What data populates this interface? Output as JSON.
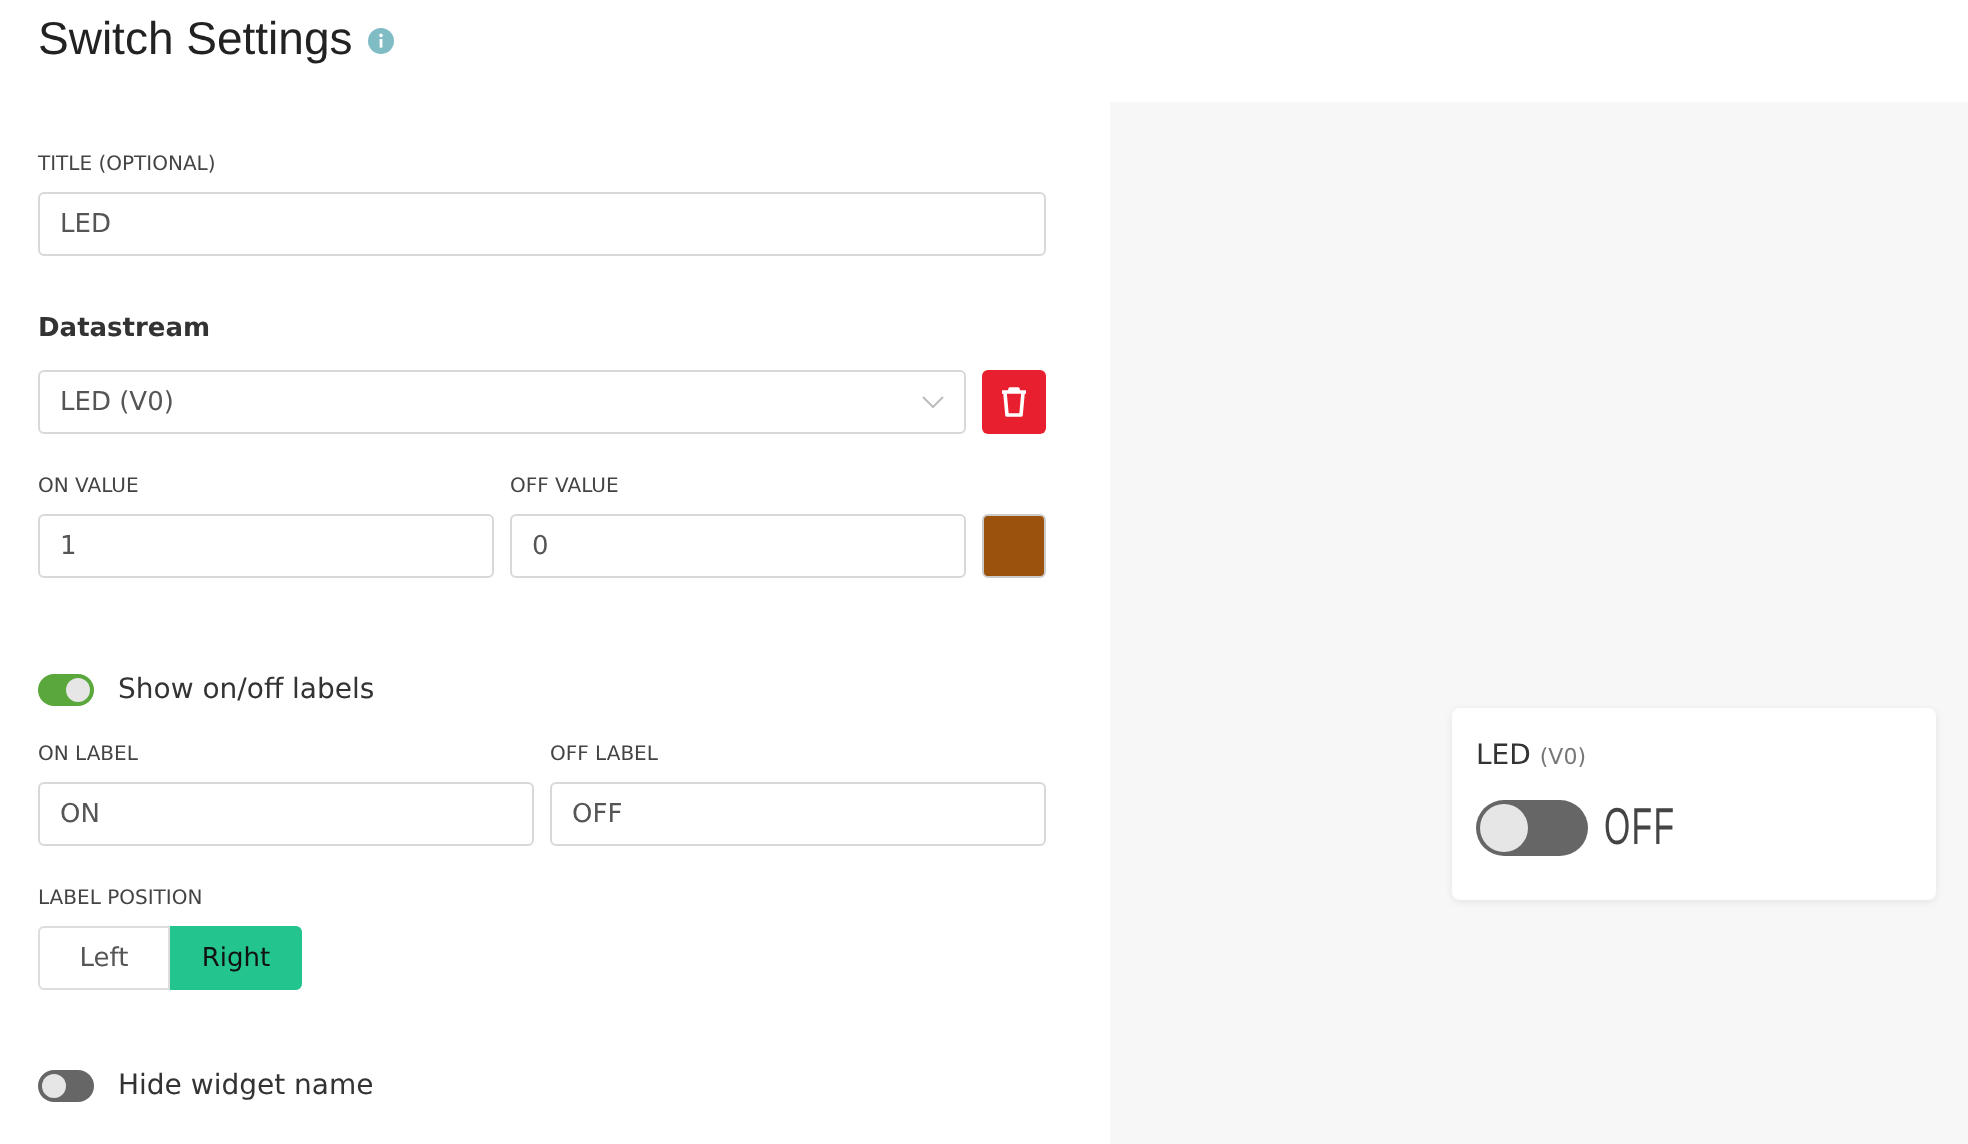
{
  "header": {
    "title": "Switch Settings"
  },
  "title_field": {
    "label": "TITLE (OPTIONAL)",
    "value": "LED"
  },
  "datastream": {
    "label": "Datastream",
    "value": "LED (V0)"
  },
  "values": [
    {
      "label": "ON VALUE",
      "value": "1"
    },
    {
      "label": "OFF VALUE",
      "value": "0"
    }
  ],
  "value_color": {
    "color": "#9a520c"
  },
  "show_labels": {
    "label": "Show on/off labels",
    "on": true
  },
  "label_fields": [
    {
      "label": "ON LABEL",
      "value": "ON"
    },
    {
      "label": "OFF LABEL",
      "value": "OFF"
    }
  ],
  "label_position": {
    "label": "LABEL POSITION",
    "options": [
      {
        "label": "Left",
        "selected": false
      },
      {
        "label": "Right",
        "selected": true
      }
    ]
  },
  "hide_name": {
    "label": "Hide widget name",
    "on": false
  },
  "preview": {
    "name": "LED",
    "pin": "(V0)",
    "on": false,
    "state_label": "OFF"
  }
}
